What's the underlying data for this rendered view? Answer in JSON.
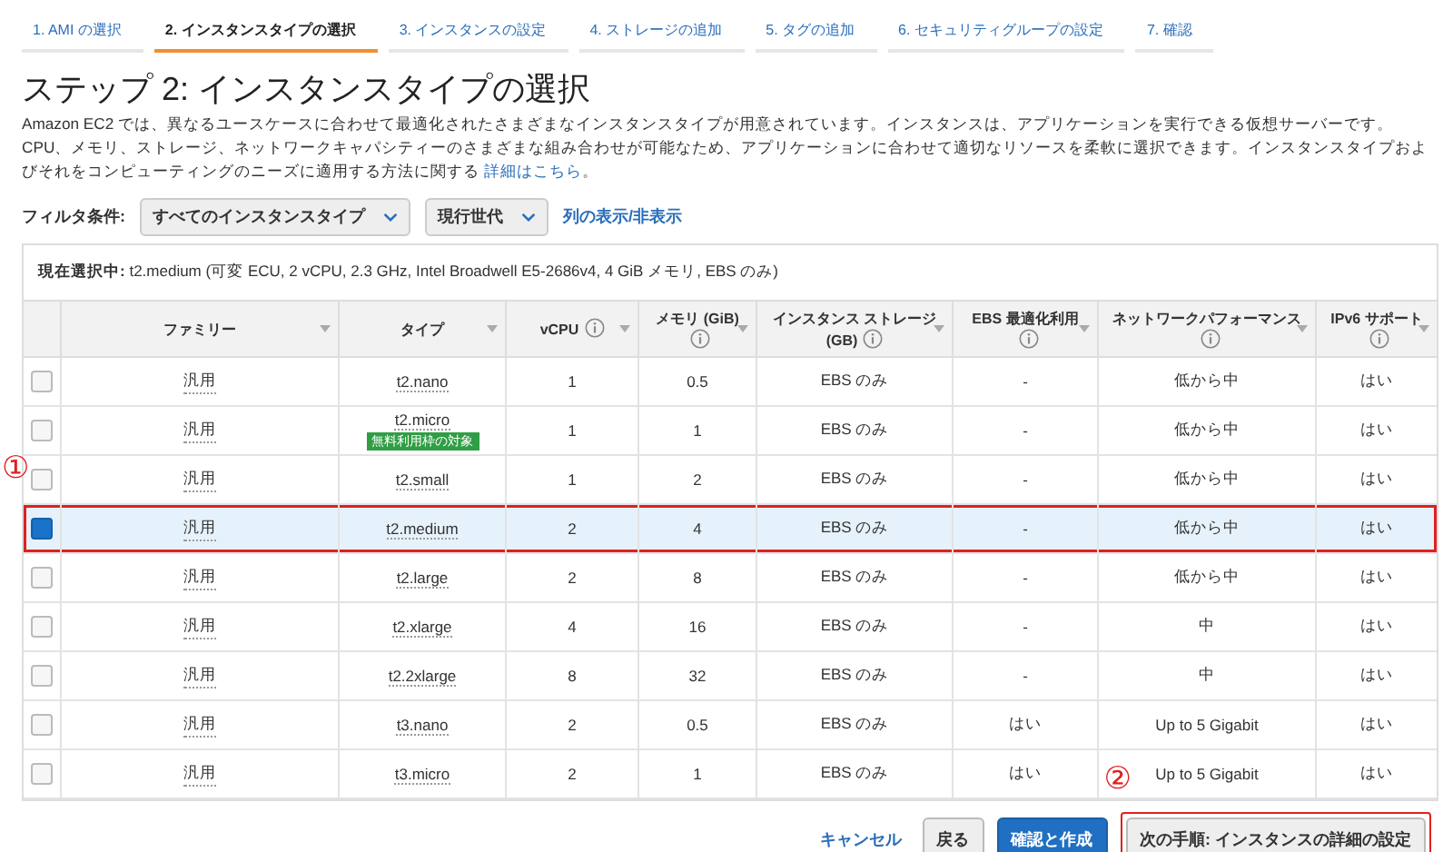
{
  "wizard_tabs": [
    {
      "label": "1. AMI の選択",
      "selected": false
    },
    {
      "label": "2. インスタンスタイプの選択",
      "selected": true
    },
    {
      "label": "3. インスタンスの設定",
      "selected": false
    },
    {
      "label": "4. ストレージの追加",
      "selected": false
    },
    {
      "label": "5. タグの追加",
      "selected": false
    },
    {
      "label": "6. セキュリティグループの設定",
      "selected": false
    },
    {
      "label": "7. 確認",
      "selected": false
    }
  ],
  "title": "ステップ 2: インスタンスタイプの選択",
  "description": {
    "text": "Amazon EC2 では、異なるユースケースに合わせて最適化されたさまざまなインスタンスタイプが用意されています。インスタンスは、アプリケーションを実行できる仮想サーバーです。CPU、メモリ、ストレージ、ネットワークキャパシティーのさまざまな組み合わせが可能なため、アプリケーションに合わせて適切なリソースを柔軟に選択できます。インスタンスタイプおよびそれをコンピューティングのニーズに適用する方法に関する",
    "link": "詳細はこちら",
    "end": "。"
  },
  "filter": {
    "label": "フィルタ条件:",
    "type_select": "すべてのインスタンスタイプ",
    "generation_select": "現行世代",
    "columns_link": "列の表示/非表示"
  },
  "current_selection": "**現在選択中:** t2.medium (可変 ECU, 2 vCPU, 2.3 GHz, Intel Broadwell E5-2686v4, 4 GiB メモリ, EBS のみ)",
  "table": {
    "columns": [
      {
        "label": "ファミリー",
        "info": false
      },
      {
        "label": "タイプ",
        "info": false
      },
      {
        "label": "vCPU",
        "info": true
      },
      {
        "label": "メモリ (GiB)",
        "info": true
      },
      {
        "label": "インスタンス ストレージ (GB)",
        "info": true
      },
      {
        "label": "EBS 最適化利用",
        "info": true
      },
      {
        "label": "ネットワークパフォーマンス",
        "info": true
      },
      {
        "label": "IPv6 サポート",
        "info": true
      }
    ],
    "rows": [
      {
        "selected": false,
        "outlined": false,
        "cells": [
          "汎用",
          "t2.nano",
          "1",
          "0.5",
          "EBS のみ",
          "-",
          "低から中",
          "はい"
        ]
      },
      {
        "selected": false,
        "outlined": false,
        "cells": [
          "汎用",
          "t2.micro",
          "1",
          "1",
          "EBS のみ",
          "-",
          "低から中",
          "はい"
        ],
        "badge": "無料利用枠の対象"
      },
      {
        "selected": false,
        "outlined": false,
        "cells": [
          "汎用",
          "t2.small",
          "1",
          "2",
          "EBS のみ",
          "-",
          "低から中",
          "はい"
        ]
      },
      {
        "selected": true,
        "outlined": true,
        "cells": [
          "汎用",
          "t2.medium",
          "2",
          "4",
          "EBS のみ",
          "-",
          "低から中",
          "はい"
        ]
      },
      {
        "selected": false,
        "outlined": false,
        "cells": [
          "汎用",
          "t2.large",
          "2",
          "8",
          "EBS のみ",
          "-",
          "低から中",
          "はい"
        ]
      },
      {
        "selected": false,
        "outlined": false,
        "cells": [
          "汎用",
          "t2.xlarge",
          "4",
          "16",
          "EBS のみ",
          "-",
          "中",
          "はい"
        ]
      },
      {
        "selected": false,
        "outlined": false,
        "cells": [
          "汎用",
          "t2.2xlarge",
          "8",
          "32",
          "EBS のみ",
          "-",
          "中",
          "はい"
        ]
      },
      {
        "selected": false,
        "outlined": false,
        "cells": [
          "汎用",
          "t3.nano",
          "2",
          "0.5",
          "EBS のみ",
          "はい",
          "Up to 5 Gigabit",
          "はい"
        ]
      },
      {
        "selected": false,
        "outlined": false,
        "cells": [
          "汎用",
          "t3.micro",
          "2",
          "1",
          "EBS のみ",
          "はい",
          "Up to 5 Gigabit",
          "はい"
        ]
      }
    ]
  },
  "buttons": [
    {
      "label": "キャンセル",
      "kind": "link",
      "outlined": false
    },
    {
      "label": "戻る",
      "kind": "secondary",
      "outlined": false
    },
    {
      "label": "確認と作成",
      "kind": "primary",
      "outlined": false
    },
    {
      "label": "次の手順: インスタンスの詳細の設定",
      "kind": "secondary",
      "outlined": true
    }
  ],
  "annotations": [
    "①",
    "②"
  ]
}
